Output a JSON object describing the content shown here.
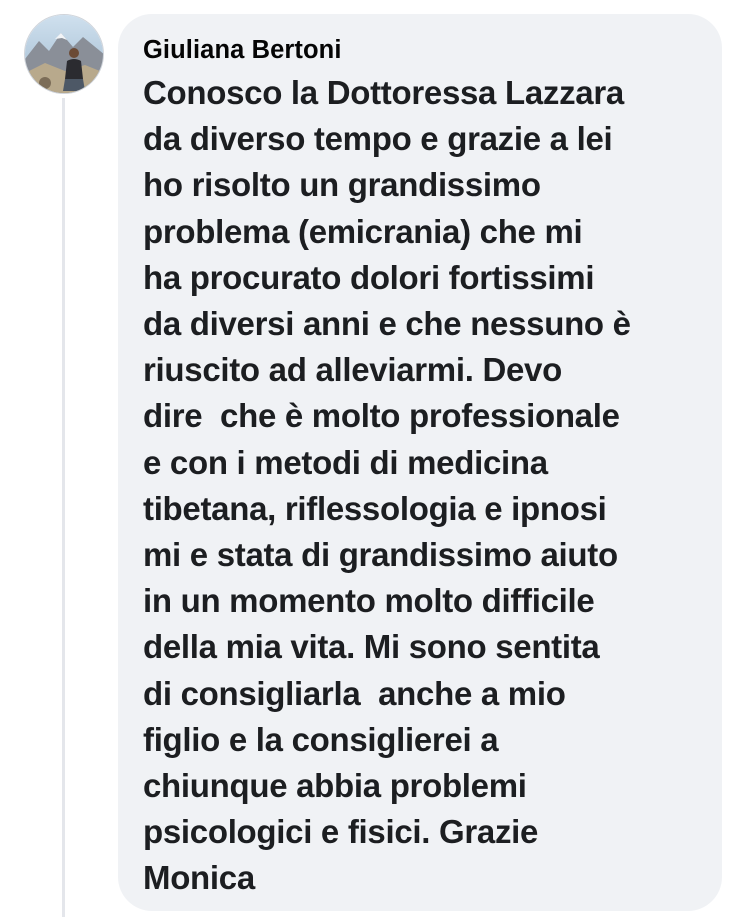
{
  "comment": {
    "author_name": "Giuliana Bertoni",
    "avatar_icon": "user-avatar-photo",
    "body_lines": [
      "Conosco la Dottoressa Lazzara",
      "da diverso tempo e grazie a lei",
      "ho risolto un grandissimo",
      "problema (emicrania) che mi",
      "ha procurato dolori fortissimi",
      "da diversi anni e che nessuno è",
      "riuscito ad alleviarmi. Devo",
      "dire  che è molto professionale",
      "e con i metodi di medicina",
      "tibetana, riflessologia e ipnosi",
      "mi e stata di grandissimo aiuto",
      "in un momento molto difficile",
      "della mia vita. Mi sono sentita",
      "di consigliarla  anche a mio",
      "figlio e la consiglierei a",
      "chiunque abbia problemi",
      "psicologici e fisici. Grazie",
      "Monica"
    ]
  },
  "colors": {
    "bubble_background": "#f0f2f5",
    "text": "#1c1e21",
    "thread_line": "#e4e6eb"
  }
}
